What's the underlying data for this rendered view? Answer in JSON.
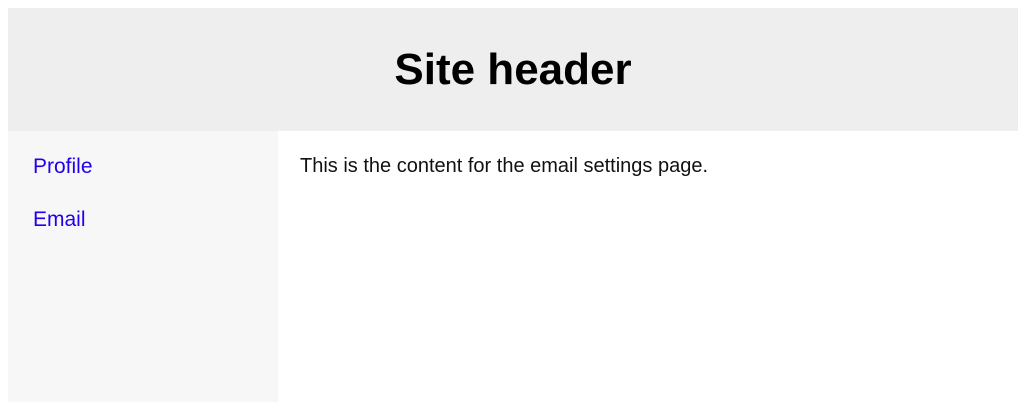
{
  "header": {
    "title": "Site header",
    "background": "#eeeeee"
  },
  "sidebar": {
    "items": [
      {
        "label": "Profile"
      },
      {
        "label": "Email"
      }
    ],
    "background": "#f7f7f7",
    "link_color": "#2200ee"
  },
  "main": {
    "content_text": "This is the content for the email settings page."
  }
}
